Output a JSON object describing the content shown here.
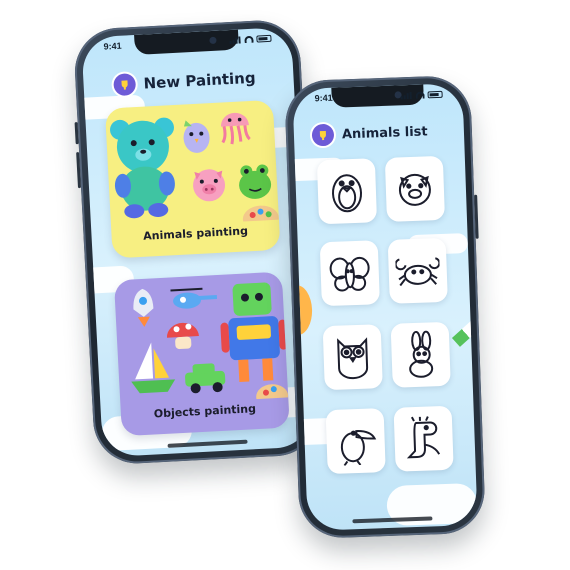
{
  "status": {
    "time": "9:41"
  },
  "phone1": {
    "title": "New Painting",
    "cards": [
      {
        "label": "Animals painting",
        "color": "#f7ef82"
      },
      {
        "label": "Objects painting",
        "color": "#a79ae6"
      }
    ]
  },
  "phone2": {
    "title": "Animals list",
    "items": [
      {
        "name": "penguin-icon"
      },
      {
        "name": "pig-icon"
      },
      {
        "name": "butterfly-icon"
      },
      {
        "name": "crab-icon"
      },
      {
        "name": "owl-icon"
      },
      {
        "name": "rabbit-icon"
      },
      {
        "name": "toucan-icon"
      },
      {
        "name": "dinosaur-icon"
      }
    ]
  },
  "colors": {
    "accent": "#6d5bd7",
    "sky": "#c9ebfb"
  }
}
